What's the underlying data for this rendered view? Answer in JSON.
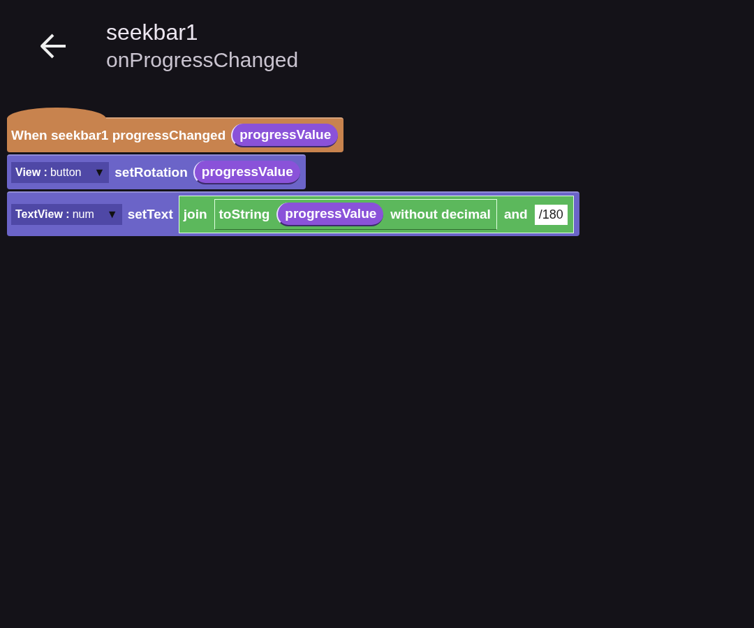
{
  "header": {
    "title": "seekbar1",
    "subtitle": "onProgressChanged"
  },
  "blocks": [
    {
      "kind": "event",
      "parts": [
        {
          "kind": "text",
          "text": "When seekbar1 progressChanged"
        },
        {
          "kind": "var",
          "text": "progressValue"
        }
      ]
    },
    {
      "kind": "command",
      "parts": [
        {
          "kind": "dropdown",
          "label": "View :",
          "value": "button",
          "arrow": "▼"
        },
        {
          "kind": "text",
          "text": "setRotation"
        },
        {
          "kind": "var",
          "text": "progressValue"
        }
      ]
    },
    {
      "kind": "command",
      "parts": [
        {
          "kind": "dropdown",
          "label": "TextView :",
          "value": "num",
          "arrow": "▼"
        },
        {
          "kind": "text",
          "text": "setText"
        },
        {
          "kind": "op",
          "parts": [
            {
              "kind": "text",
              "text": "join"
            },
            {
              "kind": "op",
              "parts": [
                {
                  "kind": "text",
                  "text": "toString"
                },
                {
                  "kind": "var",
                  "text": "progressValue"
                },
                {
                  "kind": "text",
                  "text": "without decimal"
                }
              ]
            },
            {
              "kind": "text",
              "text": "and"
            },
            {
              "kind": "literal",
              "text": "/180"
            }
          ]
        }
      ]
    }
  ]
}
